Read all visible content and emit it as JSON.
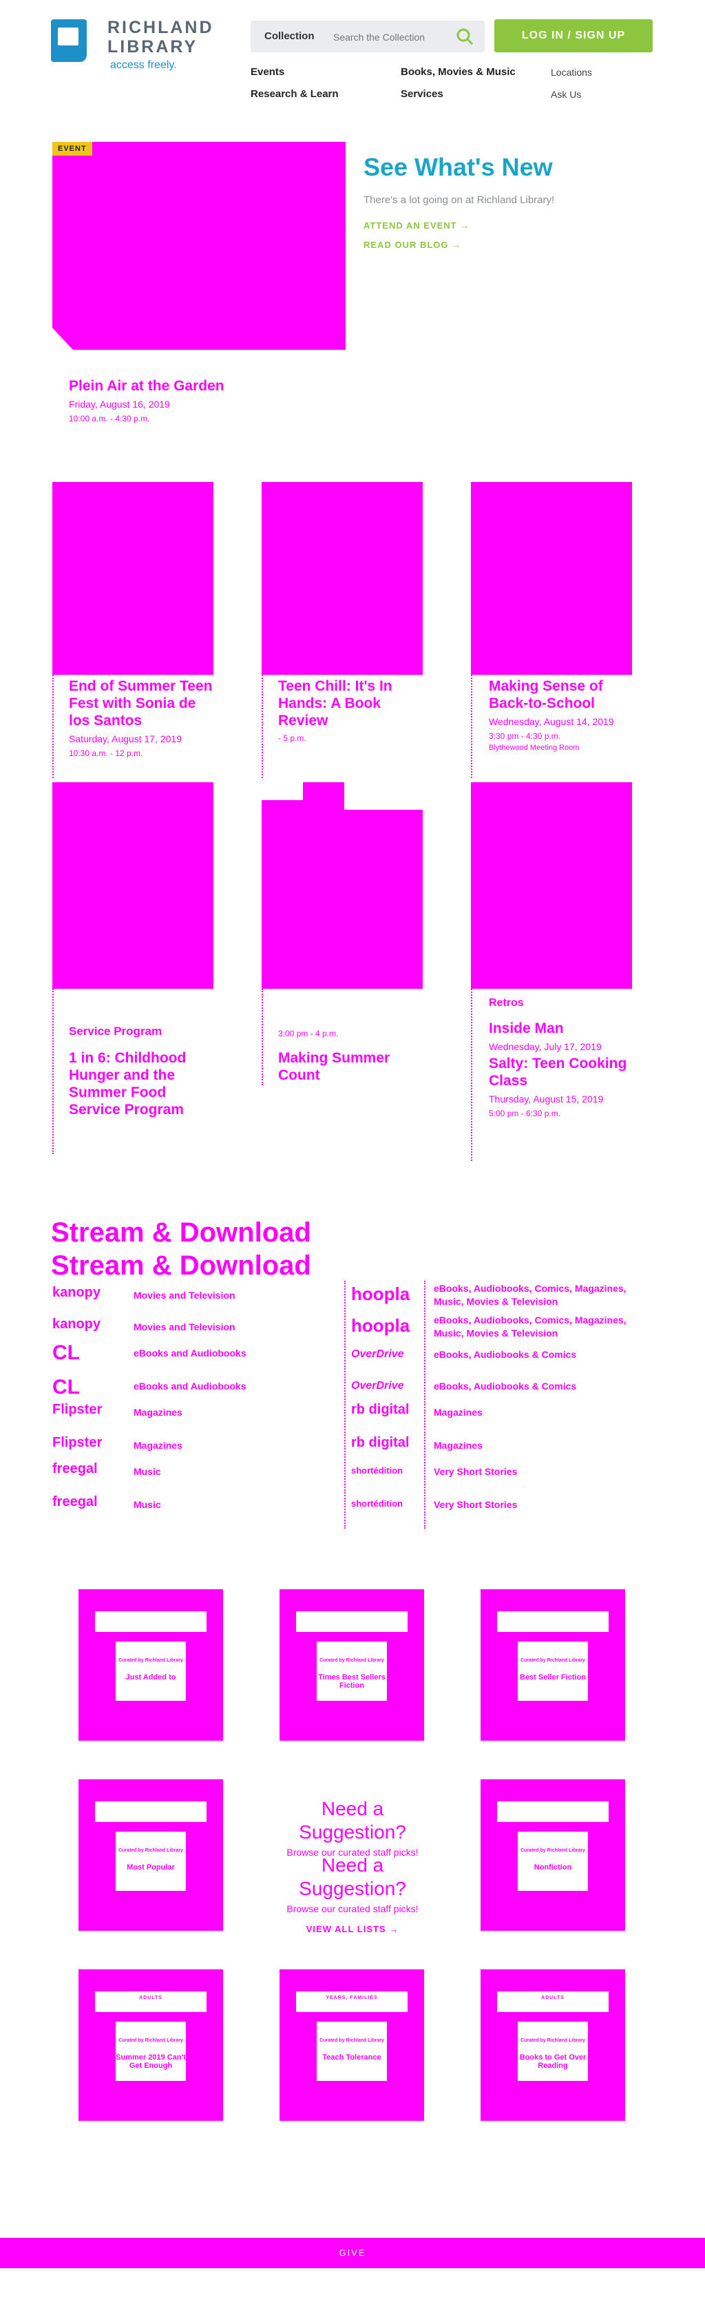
{
  "header": {
    "logo_name_line1": "RICHLAND",
    "logo_name_line2": "LIBRARY",
    "logo_tagline": "access freely.",
    "search_scope": "Collection",
    "search_placeholder": "Search the Collection",
    "login_label": "LOG IN / SIGN UP",
    "nav": [
      "Events",
      "Books, Movies & Music",
      "Locations",
      "Research & Learn",
      "Services",
      "Ask Us"
    ]
  },
  "hero": {
    "badge": "EVENT",
    "title": "See What's New",
    "subtitle": "There's a lot going on at Richland Library!",
    "link1": "ATTEND AN EVENT →",
    "link2": "READ OUR BLOG →",
    "event_title": "Plein Air at the Garden",
    "event_date": "Friday, August 16, 2019",
    "event_time": "10:00 a.m. - 4:30 p.m."
  },
  "events": [
    {
      "title": "End of Summer Teen Fest with Sonia de los Santos",
      "date": "Saturday, August 17, 2019",
      "time": "10:30 a.m. - 12 p.m."
    },
    {
      "title": "Teen Chill: It's In Hands: A Book Review",
      "date": "",
      "time": "- 5 p.m."
    },
    {
      "title": "Making Sense of Back-to-School",
      "date": "Wednesday, August 14, 2019",
      "time": "3:30 pm - 4:30 p.m.",
      "location": "Blythewood Meeting Room"
    },
    {
      "title": "1 in 6: Childhood Hunger and the Summer Food Service Program",
      "date": "",
      "time": ""
    },
    {
      "title": "Making Summer Count",
      "date": "",
      "time": "3:00 pm - 4 p.m."
    },
    {
      "title": "Inside Man",
      "date": "Wednesday, July 17, 2019",
      "time": ""
    },
    {
      "title": "Salty: Teen Cooking Class",
      "date": "Thursday, August 15, 2019",
      "time": "5:00 pm - 6:30 p.m."
    }
  ],
  "event_tags": {
    "card4": "Service Program",
    "card6": "Retros"
  },
  "stream": {
    "title": "Stream & Download",
    "left": [
      {
        "brand": "kanopy",
        "desc": "Movies and Television"
      },
      {
        "brand": "CL",
        "desc": "eBooks and Audiobooks"
      },
      {
        "brand": "Flipster",
        "desc": "Magazines"
      },
      {
        "brand": "freegal",
        "desc": "Music"
      }
    ],
    "right": [
      {
        "brand": "hoopla",
        "desc": "eBooks, Audiobooks, Comics, Magazines, Music, Movies & Television"
      },
      {
        "brand": "OverDrive",
        "desc": "eBooks, Audiobooks & Comics"
      },
      {
        "brand": "rb digital",
        "desc": "Magazines"
      },
      {
        "brand": "shortédition",
        "desc": "Very Short Stories"
      }
    ]
  },
  "lists": {
    "suggest_title": "Need a Suggestion?",
    "suggest_sub": "Browse our curated staff picks!",
    "view_all": "VIEW ALL LISTS →",
    "books": [
      {
        "pre": "",
        "curated": "Curated by Richland Library",
        "title": "Just Added to"
      },
      {
        "pre": "",
        "curated": "Curated by Richland Library",
        "title": "Times Best Sellers Fiction"
      },
      {
        "pre": "",
        "curated": "Curated by Richland Library",
        "title": "Best Seller Fiction"
      },
      {
        "pre": "",
        "curated": "Curated by Richland Library",
        "title": "Most Popular"
      },
      {
        "pre": "",
        "curated": "Curated by Richland Library",
        "title": "Nonfiction"
      },
      {
        "pre": "ADULTS",
        "curated": "Curated by Richland Library",
        "title": "Summer 2019 Can't Get Enough"
      },
      {
        "pre": "YEARS, FAMILIES",
        "curated": "Curated by Richland Library",
        "title": "Teach Tolerance"
      },
      {
        "pre": "ADULTS",
        "curated": "Curated by Richland Library",
        "title": "Books to Get Over Reading"
      }
    ]
  },
  "footer": {
    "label": "GIVE"
  },
  "colors": {
    "accent_blue": "#19a5c9",
    "brand_green": "#8cc63f",
    "placeholder_magenta": "#ff00ff"
  }
}
